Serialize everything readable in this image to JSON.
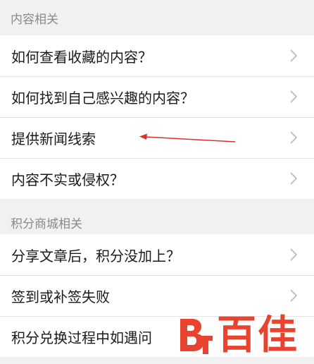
{
  "sections": [
    {
      "header": "内容相关",
      "items": [
        {
          "label": "如何查看收藏的内容？"
        },
        {
          "label": "如何找到自己感兴趣的内容？"
        },
        {
          "label": "提供新闻线索"
        },
        {
          "label": "内容不实或侵权？"
        }
      ]
    },
    {
      "header": "积分商城相关",
      "items": [
        {
          "label": "分享文章后，积分没加上？"
        },
        {
          "label": "签到或补签失败"
        },
        {
          "label": "积分兑换过程中如遇问"
        }
      ]
    }
  ],
  "annotation": {
    "color": "#d9312a"
  },
  "watermark": {
    "text": "百佳",
    "color": "#e8432f"
  },
  "icons": {
    "chevron": "chevron-right-icon"
  }
}
